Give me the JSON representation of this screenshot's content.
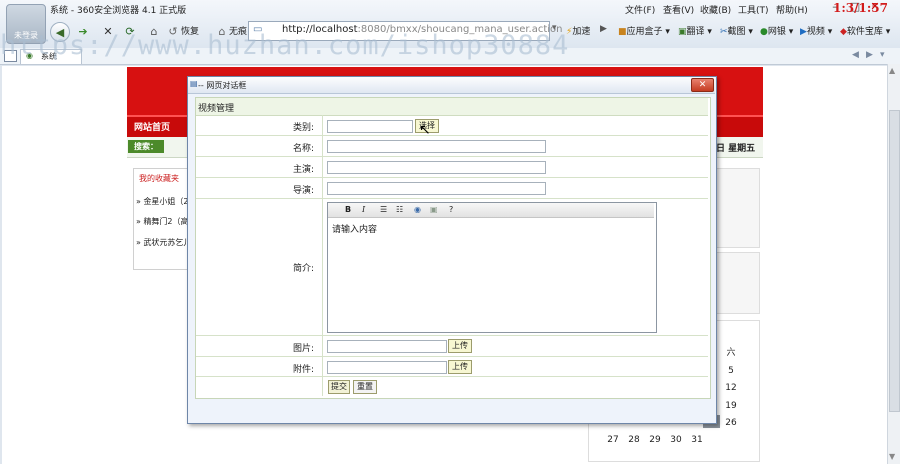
{
  "browser": {
    "avatar_label": "未登录",
    "window_title": "系统 - 360安全浏览器 4.1 正式版",
    "menus": [
      "文件(F)",
      "查看(V)",
      "收藏(B)",
      "工具(T)",
      "帮助(H)"
    ],
    "clock": "1:3/1:57",
    "restore_label": "恢复",
    "no_image_label": "无痕",
    "address": {
      "host": "http://localhost",
      "path": ":8080/bmxx/shoucang_mana_user.action"
    },
    "speed_label": "加速",
    "tools": [
      "应用盒子",
      "翻译",
      "截图",
      "网银",
      "视频",
      "软件宝库"
    ],
    "tab_label": "系统"
  },
  "background_page": {
    "nav_home": "网站首页",
    "search_label": "搜索：",
    "date_text": "日 星期五",
    "favorites_title": "我的收藏夹",
    "favorites": [
      "金星小姐（2",
      "精舞门2（高",
      "武状元苏乞儿"
    ],
    "calendar_rows": [
      [
        "六"
      ],
      [
        "5"
      ],
      [
        "12"
      ],
      [
        "19"
      ],
      [
        "27",
        "28",
        "29",
        "30",
        "31"
      ]
    ],
    "calendar_row2": [
      "26"
    ]
  },
  "dialog": {
    "title": "-- 网页对话框",
    "close_label": "✕",
    "section_title": "视频管理",
    "fields": {
      "category_label": "类别:",
      "category_value": "",
      "category_button": "选择",
      "name_label": "名称:",
      "actor_label": "主演:",
      "director_label": "导演:",
      "intro_label": "简介:",
      "intro_content": "请输入内容",
      "image_label": "图片:",
      "image_button": "上传",
      "attachment_label": "附件:",
      "attachment_button": "上传"
    },
    "submit_label": "提交",
    "reset_label": "重置"
  },
  "watermark": "https://www.huzhan.com/ishop30884"
}
